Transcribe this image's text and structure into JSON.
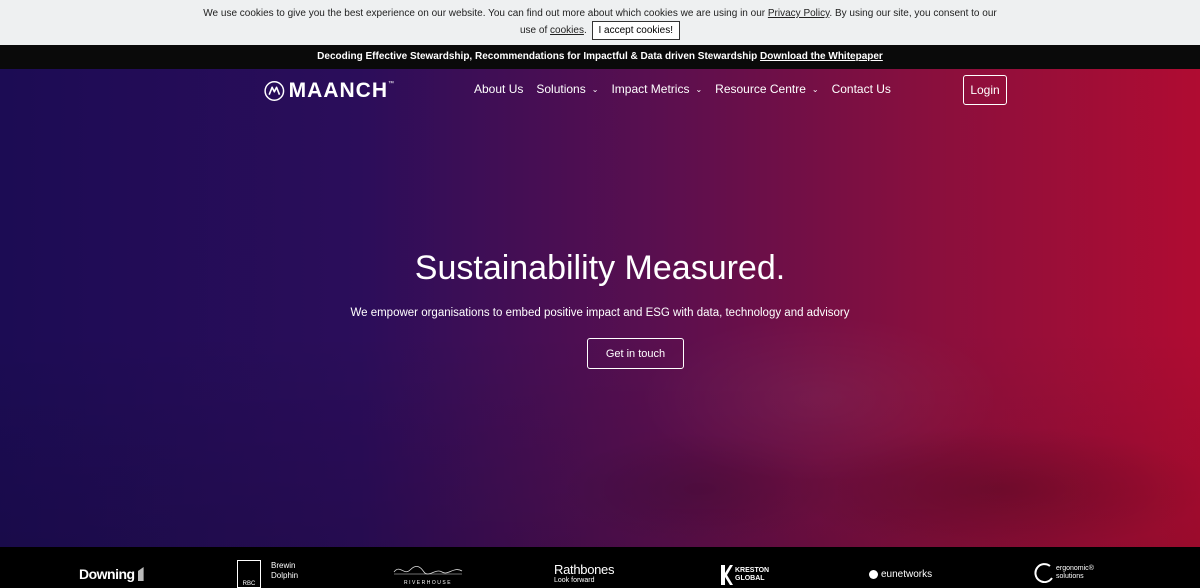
{
  "cookie_bar": {
    "text_before": "We use cookies to give you the best experience on our website. You can find out more about which cookies we are using in our",
    "privacy_link": "Privacy Policy",
    "text_middle": ". By using our site, you consent to our use of",
    "cookies_link": "cookies",
    "period": ".",
    "accept_button": "I accept cookies!"
  },
  "announcement": {
    "text": "Decoding Effective Stewardship, Recommendations for Impactful & Data driven Stewardship",
    "link": "Download the Whitepaper"
  },
  "header": {
    "logo_text": "MAANCH",
    "logo_tm": "™",
    "nav": [
      {
        "label": "About Us",
        "has_dropdown": false
      },
      {
        "label": "Solutions",
        "has_dropdown": true
      },
      {
        "label": "Impact Metrics",
        "has_dropdown": true
      },
      {
        "label": "Resource Centre",
        "has_dropdown": true
      },
      {
        "label": "Contact Us",
        "has_dropdown": false
      }
    ],
    "login": "Login"
  },
  "hero": {
    "title": "Sustainability Measured.",
    "subtitle": "We empower organisations to embed positive impact and ESG with data, technology and advisory",
    "cta": "Get in touch"
  },
  "partners": {
    "downing": "Downing",
    "rbc_mark": "RBC",
    "brewin_1": "Brewin",
    "brewin_2": "Dolphin",
    "riverhouse": "RIVERHOUSE",
    "rathbones": "Rathbones",
    "rathbones_tag": "Look forward",
    "kreston_1": "KRESTON",
    "kreston_2": "GLOBAL",
    "eunetworks": "eunetworks",
    "ergo_1": "ergonomic",
    "ergo_2": "solutions",
    "ergo_tm": "®"
  },
  "colors": {
    "hero_left": "#1c0c54",
    "hero_right": "#b00c32",
    "cookie_bg": "#eef0f1",
    "announce_bg": "#0a0a0a"
  }
}
